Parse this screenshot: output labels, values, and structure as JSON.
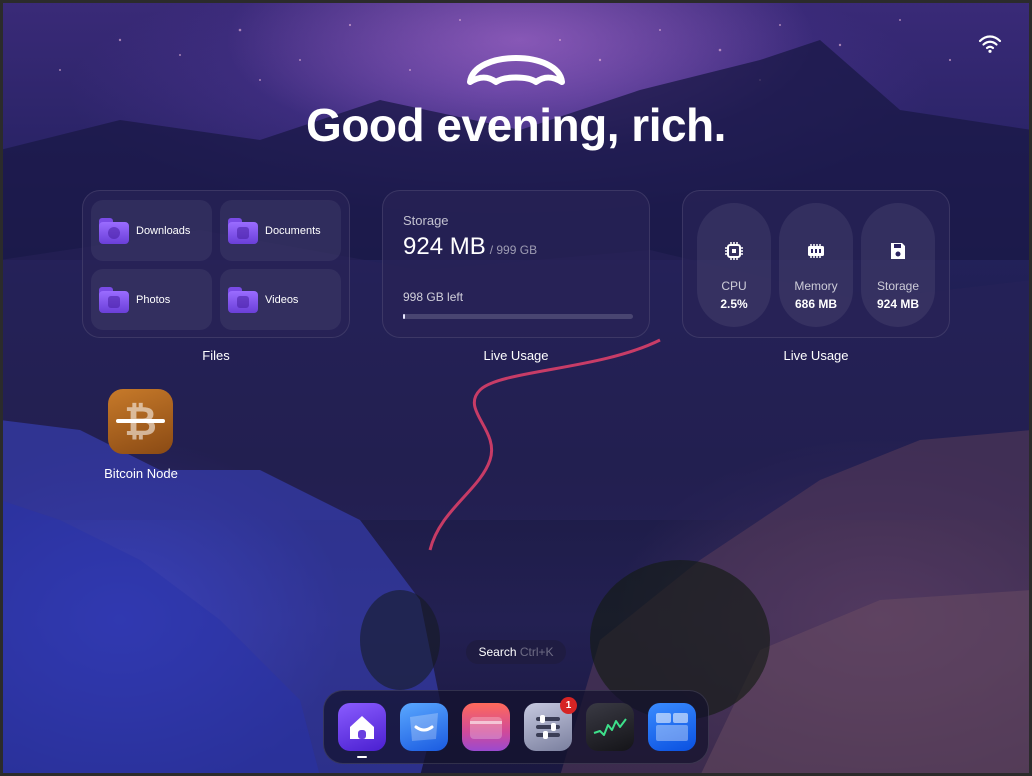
{
  "greeting": "Good evening, rich.",
  "files_widget": {
    "label": "Files",
    "folders": [
      {
        "name": "Downloads",
        "icon": "download-folder-icon"
      },
      {
        "name": "Documents",
        "icon": "documents-folder-icon"
      },
      {
        "name": "Photos",
        "icon": "photos-folder-icon"
      },
      {
        "name": "Videos",
        "icon": "videos-folder-icon"
      }
    ]
  },
  "storage_widget": {
    "label": "Live Usage",
    "title": "Storage",
    "used": "924 MB",
    "total": "/ 999 GB",
    "left": "998 GB left",
    "used_fraction": 0.001
  },
  "stats_widget": {
    "label": "Live Usage",
    "items": [
      {
        "name": "CPU",
        "value": "2.5%",
        "icon": "cpu-icon"
      },
      {
        "name": "Memory",
        "value": "686 MB",
        "icon": "memory-icon"
      },
      {
        "name": "Storage",
        "value": "924 MB",
        "icon": "disk-icon"
      }
    ]
  },
  "desktop_apps": [
    {
      "name": "Bitcoin Node",
      "icon": "bitcoin-icon"
    }
  ],
  "search": {
    "label": "Search",
    "shortcut": "Ctrl+K"
  },
  "dock": {
    "items": [
      {
        "name": "home",
        "icon": "home-icon",
        "active": true
      },
      {
        "name": "app-store",
        "icon": "app-store-icon"
      },
      {
        "name": "files",
        "icon": "files-icon"
      },
      {
        "name": "settings",
        "icon": "settings-icon",
        "badge": "1"
      },
      {
        "name": "live-usage",
        "icon": "activity-icon"
      },
      {
        "name": "widgets",
        "icon": "widgets-icon"
      }
    ]
  },
  "colors": {
    "accent": "#7a4be6",
    "badge": "#d62424"
  }
}
